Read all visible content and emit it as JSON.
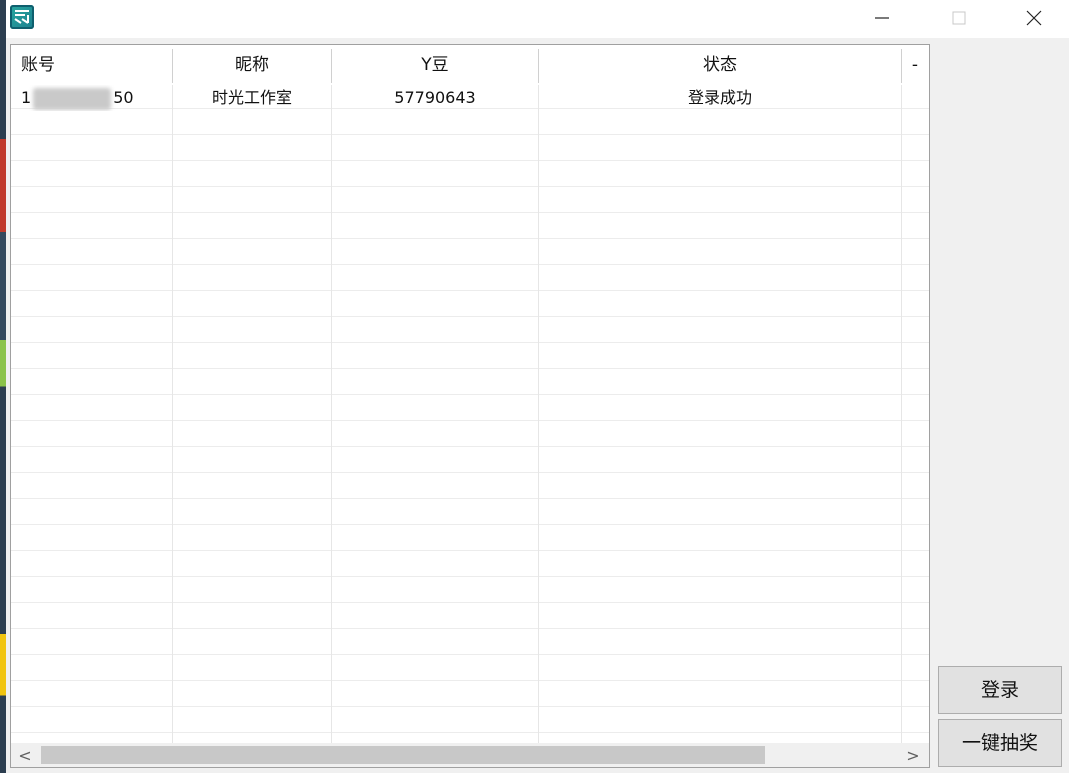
{
  "window": {
    "icon": "app-logo-icon",
    "controls": [
      "minimize-icon",
      "maximize-icon",
      "close-icon"
    ]
  },
  "grid": {
    "columns": [
      "账号",
      "昵称",
      "Y豆",
      "状态",
      "-"
    ],
    "rows": [
      {
        "account_prefix": "1",
        "account_suffix": "50",
        "nickname": "时光工作室",
        "beans": "57790643",
        "status": "登录成功"
      }
    ],
    "scroll_left": "<",
    "scroll_right": ">"
  },
  "buttons": {
    "login": "登录",
    "draw_all": "一键抽奖"
  }
}
